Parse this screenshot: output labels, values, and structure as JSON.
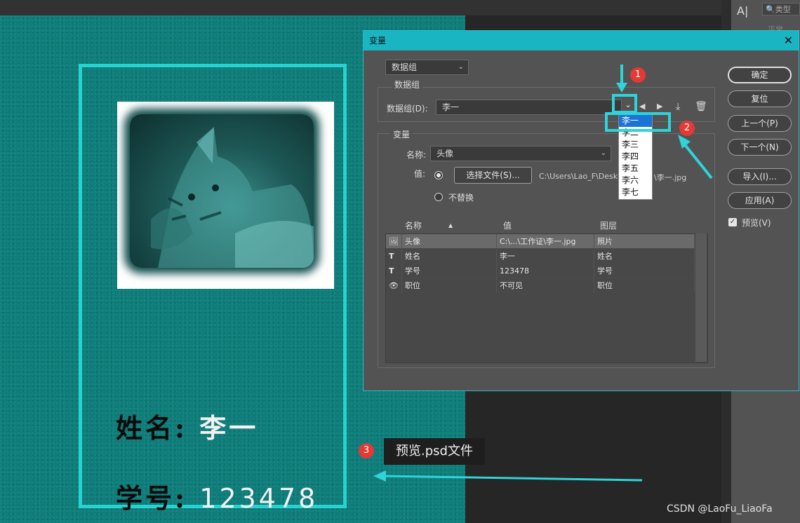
{
  "right_panel": {
    "tool_glyph": "A|",
    "search_placeholder": "类型",
    "search_sub": "正常"
  },
  "document": {
    "name_label": "姓名:",
    "name_value": "李一",
    "id_label": "学号:",
    "id_value": "123478"
  },
  "dialog": {
    "title": "变量",
    "close": "✕",
    "mode_select": "数据组",
    "dataset_group_label": "数据组",
    "dataset_field_label": "数据组(D):",
    "dataset_value": "李一",
    "dataset_options": [
      "李一",
      "李二",
      "李三",
      "李四",
      "李五",
      "李六",
      "李七"
    ],
    "variables_group_label": "变量",
    "name_label": "名称:",
    "name_value": "头像",
    "value_label": "值:",
    "choose_file_button": "选择文件(S)...",
    "file_path_left": "C:\\Users\\Lao_F\\Deskto",
    "file_path_right": "\\李一.jpg",
    "no_replace_label": "不替换",
    "table": {
      "headers": [
        "名称",
        "值",
        "图层"
      ],
      "rows": [
        {
          "icon": "image-icon",
          "name": "头像",
          "value": "C:\\...\\工作证\\李一.jpg",
          "layer": "照片"
        },
        {
          "icon": "text-icon",
          "name": "姓名",
          "value": "李一",
          "layer": "姓名"
        },
        {
          "icon": "text-icon",
          "name": "学号",
          "value": "123478",
          "layer": "学号"
        },
        {
          "icon": "eye-icon",
          "name": "职位",
          "value": "不可见",
          "layer": "职位"
        }
      ]
    },
    "buttons": {
      "ok": "确定",
      "reset": "复位",
      "prev": "上一个(P)",
      "next": "下一个(N)",
      "import": "导入(I)...",
      "apply": "应用(A)"
    },
    "preview_label": "预览(V)"
  },
  "annotations": {
    "marker_1": "1",
    "marker_2": "2",
    "marker_3": "3",
    "tooltip": "预览.psd文件",
    "accent": "#2fd3d8"
  },
  "watermark": "CSDN @LaoFu_LiaoFa"
}
